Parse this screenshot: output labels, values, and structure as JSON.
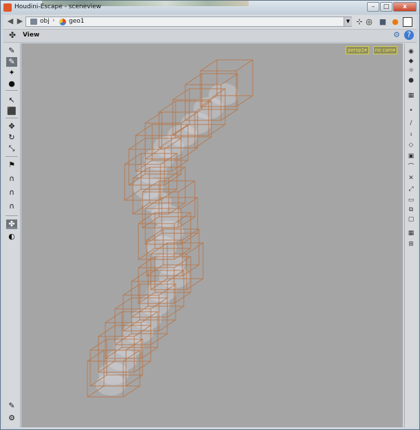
{
  "window": {
    "title": "Houdini-Escape - sceneview",
    "close_glyph": "x"
  },
  "pathbar": {
    "segments": [
      "obj",
      "geo1"
    ],
    "back_glyph": "◀",
    "forward_glyph": "▶",
    "dropdown_glyph": "▼"
  },
  "viewbar": {
    "label": "View"
  },
  "viewport": {
    "camera_menus": [
      "persp1▾",
      "no cam▾"
    ]
  },
  "colors": {
    "viewport_bg": "#a5a5a5",
    "cage_stroke": "#b8774a",
    "volume": "#e8ebef",
    "accent": "#e8e060"
  },
  "left_tools": [
    {
      "icon": "brush-icon",
      "glyph": "✎",
      "selected": false
    },
    {
      "icon": "paint-select-icon",
      "glyph": "✎",
      "selected": true
    },
    {
      "icon": "magic-icon",
      "glyph": "✦",
      "selected": false
    },
    {
      "icon": "view-lamp-icon",
      "glyph": "●",
      "selected": false
    },
    {
      "icon": "select-arrow-icon",
      "glyph": "↖",
      "selected": false
    },
    {
      "icon": "select-color-icon",
      "glyph": "⬛",
      "selected": false
    },
    {
      "icon": "move-icon",
      "glyph": "✥",
      "selected": false
    },
    {
      "icon": "rotate-icon",
      "glyph": "↻",
      "selected": false
    },
    {
      "icon": "scale-icon",
      "glyph": "⤡",
      "selected": false
    },
    {
      "icon": "handle-icon",
      "glyph": "⚑",
      "selected": false
    },
    {
      "icon": "magnet-a-icon",
      "glyph": "∩",
      "selected": false
    },
    {
      "icon": "magnet-b-icon",
      "glyph": "∩",
      "selected": false
    },
    {
      "icon": "magnet-c-icon",
      "glyph": "∩",
      "selected": false
    },
    {
      "icon": "pose-icon",
      "glyph": "✤",
      "selected": true
    },
    {
      "icon": "render-icon",
      "glyph": "◐",
      "selected": false
    }
  ],
  "right_tools": [
    "eye-icon",
    "teapot-icon",
    "light-icon",
    "sphere-icon",
    "grid-icon",
    "point-icon",
    "curve-icon",
    "number-icon",
    "box-icon",
    "cube-icon",
    "bezier-icon",
    "arrows-icon",
    "arrows-b-icon",
    "ortho-icon",
    "graph-icon",
    "frame-icon",
    "layout-icon",
    "pin-icon"
  ]
}
